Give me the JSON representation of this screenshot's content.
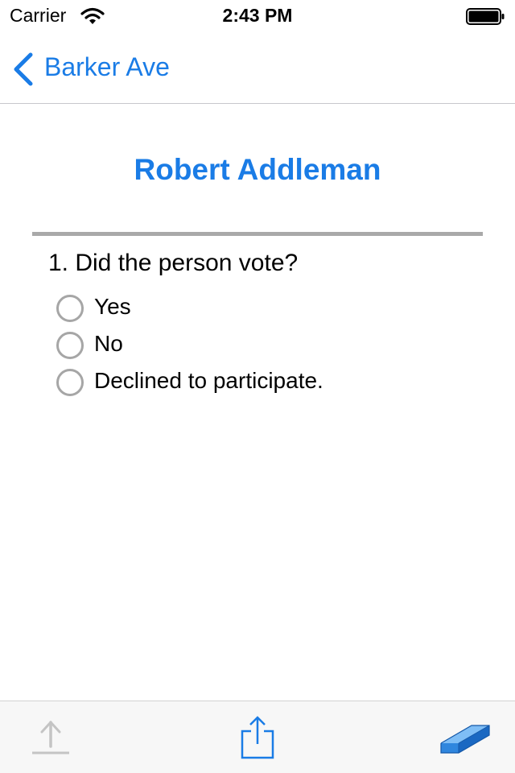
{
  "status_bar": {
    "carrier": "Carrier",
    "time": "2:43 PM",
    "icons": [
      "wifi-icon",
      "battery-icon"
    ]
  },
  "nav": {
    "back_label": "Barker Ave",
    "back_icon": "chevron-left-icon"
  },
  "person": {
    "name": "Robert Addleman"
  },
  "survey": {
    "question": "1. Did the person vote?",
    "options": [
      {
        "label": "Yes",
        "selected": false
      },
      {
        "label": "No",
        "selected": false
      },
      {
        "label": "Declined to participate.",
        "selected": false
      }
    ]
  },
  "toolbar": {
    "icons": [
      "upload-icon",
      "share-icon",
      "eraser-icon"
    ],
    "upload_enabled": false
  },
  "colors": {
    "accent": "#1a7ce6",
    "divider": "#a9a9a9",
    "radio_border": "#a6a6a6",
    "disabled": "#c4c4c4",
    "toolbar_bg": "#f7f7f7"
  }
}
